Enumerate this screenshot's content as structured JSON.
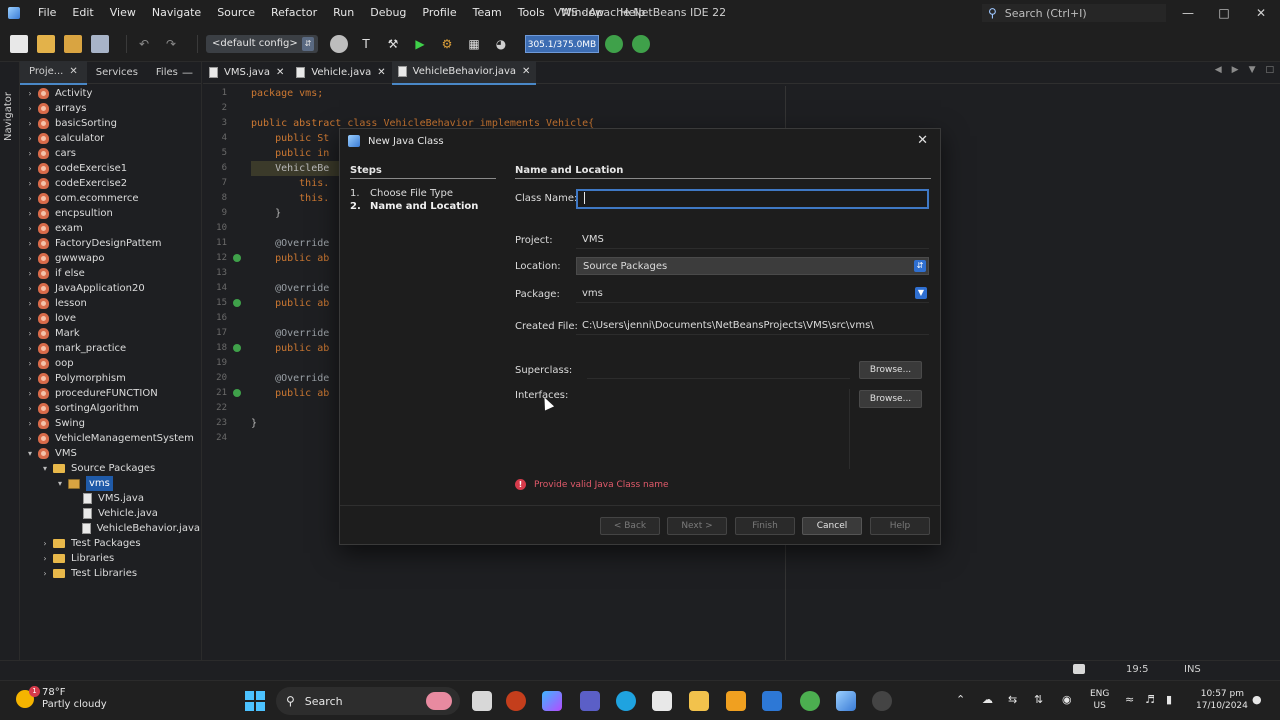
{
  "menubar": {
    "items": [
      "File",
      "Edit",
      "View",
      "Navigate",
      "Source",
      "Refactor",
      "Run",
      "Debug",
      "Profile",
      "Team",
      "Tools",
      "Window",
      "Help"
    ],
    "title": "VMS - Apache NetBeans IDE 22",
    "search_placeholder": "Search (Ctrl+I)"
  },
  "toolbar": {
    "config": "<default config>",
    "memory": "305.1/375.0MB"
  },
  "left_strip": {
    "navigator_label": "Navigator"
  },
  "project_panel": {
    "tabs": [
      "Proje...",
      "Services",
      "Files"
    ],
    "tree": [
      {
        "label": "Activity",
        "level": 0,
        "type": "project"
      },
      {
        "label": "arrays",
        "level": 0,
        "type": "project"
      },
      {
        "label": "basicSorting",
        "level": 0,
        "type": "project"
      },
      {
        "label": "calculator",
        "level": 0,
        "type": "project"
      },
      {
        "label": "cars",
        "level": 0,
        "type": "project"
      },
      {
        "label": "codeExercise1",
        "level": 0,
        "type": "project"
      },
      {
        "label": "codeExercise2",
        "level": 0,
        "type": "project"
      },
      {
        "label": "com.ecommerce",
        "level": 0,
        "type": "project"
      },
      {
        "label": "encpsultion",
        "level": 0,
        "type": "project"
      },
      {
        "label": "exam",
        "level": 0,
        "type": "project"
      },
      {
        "label": "FactoryDesignPattem",
        "level": 0,
        "type": "project"
      },
      {
        "label": "gwwwapo",
        "level": 0,
        "type": "project"
      },
      {
        "label": "if else",
        "level": 0,
        "type": "project"
      },
      {
        "label": "JavaApplication20",
        "level": 0,
        "type": "project"
      },
      {
        "label": "lesson",
        "level": 0,
        "type": "project"
      },
      {
        "label": "love",
        "level": 0,
        "type": "project"
      },
      {
        "label": "Mark",
        "level": 0,
        "type": "project"
      },
      {
        "label": "mark_practice",
        "level": 0,
        "type": "project"
      },
      {
        "label": "oop",
        "level": 0,
        "type": "project"
      },
      {
        "label": "Polymorphism",
        "level": 0,
        "type": "project"
      },
      {
        "label": "procedureFUNCTION",
        "level": 0,
        "type": "project"
      },
      {
        "label": "sortingAlgorithm",
        "level": 0,
        "type": "project"
      },
      {
        "label": "Swing",
        "level": 0,
        "type": "project"
      },
      {
        "label": "VehicleManagementSystem",
        "level": 0,
        "type": "project"
      },
      {
        "label": "VMS",
        "level": 0,
        "type": "project",
        "expanded": true
      },
      {
        "label": "Source Packages",
        "level": 1,
        "type": "folder",
        "expanded": true
      },
      {
        "label": "vms",
        "level": 2,
        "type": "package",
        "expanded": true,
        "selected": true
      },
      {
        "label": "VMS.java",
        "level": 3,
        "type": "file"
      },
      {
        "label": "Vehicle.java",
        "level": 3,
        "type": "file"
      },
      {
        "label": "VehicleBehavior.java",
        "level": 3,
        "type": "file"
      },
      {
        "label": "Test Packages",
        "level": 1,
        "type": "folder"
      },
      {
        "label": "Libraries",
        "level": 1,
        "type": "folder"
      },
      {
        "label": "Test Libraries",
        "level": 1,
        "type": "folder"
      }
    ]
  },
  "editor": {
    "tabs": [
      "VMS.java",
      "Vehicle.java",
      "VehicleBehavior.java"
    ],
    "active_tab": "VehicleBehavior.java",
    "line_numbers": [
      "1",
      "2",
      "3",
      "4",
      "5",
      "6",
      "7",
      "8",
      "9",
      "10",
      "11",
      "12",
      "13",
      "14",
      "15",
      "16",
      "17",
      "18",
      "19",
      "20",
      "21",
      "22",
      "23",
      "24"
    ],
    "lines": [
      "package vms;",
      "",
      "public abstract class VehicleBehavior implements Vehicle{",
      "    public St",
      "    public in",
      "    VehicleBe",
      "        this.",
      "        this.",
      "    }",
      "",
      "    @Override",
      "    public ab",
      "",
      "    @Override",
      "    public ab",
      "",
      "    @Override",
      "    public ab",
      "",
      "    @Override",
      "    public ab",
      "",
      "}",
      ""
    ]
  },
  "dialog": {
    "title": "New Java Class",
    "steps_heading": "Steps",
    "steps": [
      {
        "num": "1.",
        "label": "Choose File Type"
      },
      {
        "num": "2.",
        "label": "Name and Location"
      }
    ],
    "section_heading": "Name and Location",
    "class_name_label": "Class Name:",
    "class_name_value": "",
    "project_label": "Project:",
    "project_value": "VMS",
    "location_label": "Location:",
    "location_value": "Source Packages",
    "package_label": "Package:",
    "package_value": "vms",
    "created_file_label": "Created File:",
    "created_file_value": "C:\\Users\\jenni\\Documents\\NetBeansProjects\\VMS\\src\\vms\\",
    "superclass_label": "Superclass:",
    "interfaces_label": "Interfaces:",
    "browse_label": "Browse...",
    "error_message": "Provide valid Java Class name",
    "buttons": {
      "back": "< Back",
      "next": "Next >",
      "finish": "Finish",
      "cancel": "Cancel",
      "help": "Help"
    }
  },
  "statusbar": {
    "position": "19:5",
    "mode": "INS"
  },
  "taskbar": {
    "weather_temp": "78°F",
    "weather_desc": "Partly cloudy",
    "weather_badge": "1",
    "search_label": "Search",
    "lang_top": "ENG",
    "lang_bottom": "US",
    "time": "10:57 pm",
    "date": "17/10/2024"
  }
}
